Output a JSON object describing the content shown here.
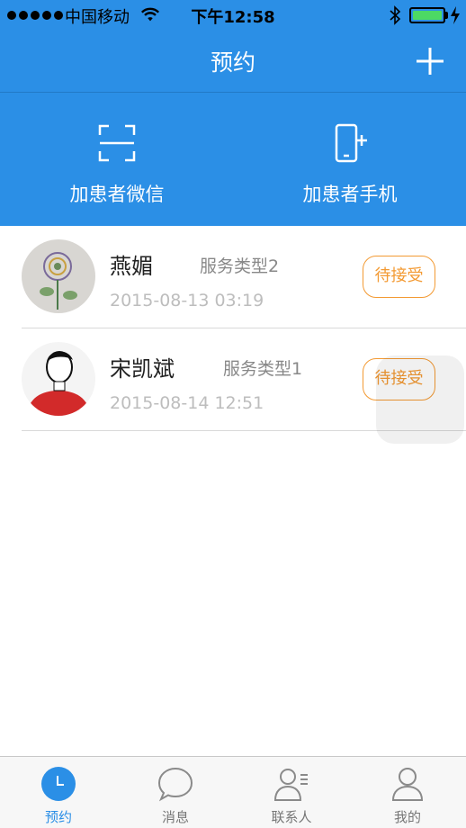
{
  "status_bar": {
    "carrier": "中国移动",
    "time": "下午12:58"
  },
  "nav": {
    "title": "预约",
    "add_icon": "plus-icon"
  },
  "actions": [
    {
      "label": "加患者微信",
      "icon": "scan-icon"
    },
    {
      "label": "加患者手机",
      "icon": "phone-add-icon"
    }
  ],
  "appointments": [
    {
      "name": "燕媚",
      "service": "服务类型2",
      "datetime": "2015-08-13 03:19",
      "status": "待接受"
    },
    {
      "name": "宋凯斌",
      "service": "服务类型1",
      "datetime": "2015-08-14 12:51",
      "status": "待接受"
    }
  ],
  "tabs": [
    {
      "label": "预约",
      "icon": "clock-icon",
      "active": true
    },
    {
      "label": "消息",
      "icon": "chat-bubble-icon",
      "active": false
    },
    {
      "label": "联系人",
      "icon": "contacts-icon",
      "active": false
    },
    {
      "label": "我的",
      "icon": "person-icon",
      "active": false
    }
  ],
  "colors": {
    "primary": "#2b8fe6",
    "accent": "#f39a33",
    "battery": "#4cd964"
  }
}
